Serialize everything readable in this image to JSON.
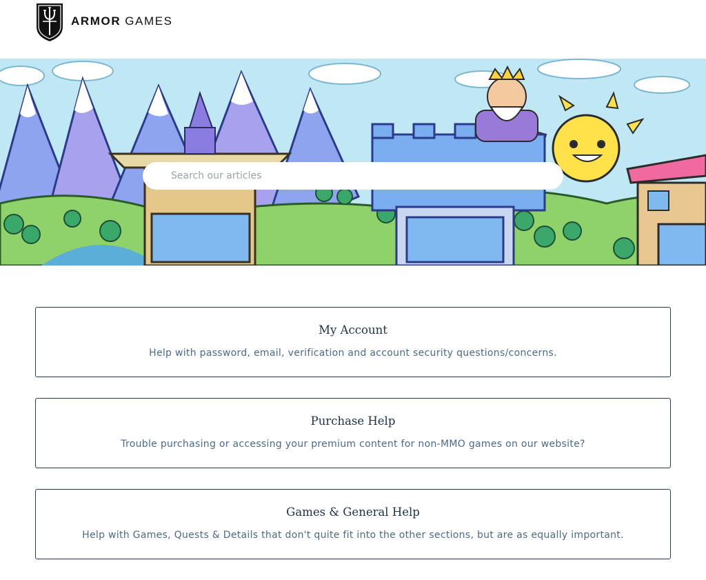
{
  "brand": {
    "name_bold": "ARMOR",
    "name_light": "GAMES"
  },
  "search": {
    "placeholder": "Search our articles"
  },
  "sections": [
    {
      "title": "My Account",
      "description": "Help with password, email, verification and account security questions/concerns."
    },
    {
      "title": "Purchase Help",
      "description": "Trouble purchasing or accessing your premium content for non-MMO games on our website?"
    },
    {
      "title": "Games & General Help",
      "description": "Help with Games, Quests & Details that don't quite fit into the other sections, but are as equally important."
    }
  ],
  "colors": {
    "border": "#1f3b57",
    "title": "#1d3146",
    "description": "#4a6a8a",
    "sky": "#bfe8f4"
  },
  "icons": {
    "logo": "shield-trident-icon"
  }
}
